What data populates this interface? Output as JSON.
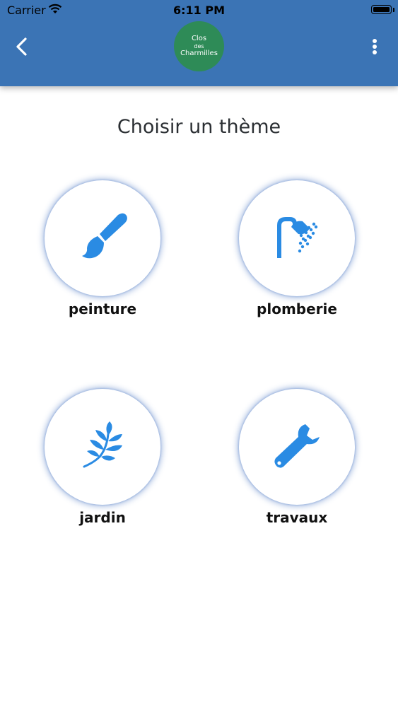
{
  "status_bar": {
    "carrier": "Carrier",
    "time": "6:11 PM"
  },
  "header": {
    "logo": {
      "line1": "Clos",
      "line2": "des",
      "line3": "Charmilles",
      "color": "#2e8b57"
    },
    "color": "#3b74b5"
  },
  "page": {
    "title": "Choisir un thème"
  },
  "themes": [
    {
      "label": "peinture",
      "icon": "paintbrush-icon"
    },
    {
      "label": "plomberie",
      "icon": "shower-icon"
    },
    {
      "label": "jardin",
      "icon": "leaf-branch-icon"
    },
    {
      "label": "travaux",
      "icon": "wrench-icon"
    }
  ],
  "icon_color": "#2a8be3"
}
